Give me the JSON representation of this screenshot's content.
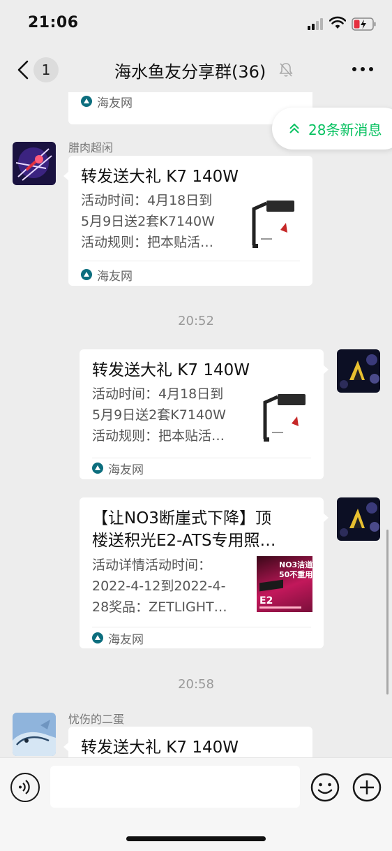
{
  "status_bar": {
    "time": "21:06"
  },
  "nav": {
    "unread_count": "1",
    "title": "海水鱼友分享群(36)"
  },
  "new_messages": {
    "label": "28条新消息"
  },
  "source_name": "海友网",
  "messages": [
    {
      "type": "card-partial",
      "side": "left",
      "source": "海友网"
    },
    {
      "type": "card",
      "side": "left",
      "sender": "腊肉超闲",
      "title_lines": [
        "转发送大礼 K7 140W"
      ],
      "desc_lines": [
        "活动时间：4月18日到",
        "5月9日送2套K7140W",
        "活动规则：把本贴活…"
      ],
      "thumb": "k7-light-icon",
      "source": "海友网"
    },
    {
      "type": "time",
      "text": "20:52"
    },
    {
      "type": "card",
      "side": "right",
      "title_lines": [
        "转发送大礼 K7 140W"
      ],
      "desc_lines": [
        "活动时间：4月18日到",
        "5月9日送2套K7140W",
        "活动规则：把本贴活…"
      ],
      "thumb": "k7-light-icon",
      "source": "海友网"
    },
    {
      "type": "card",
      "side": "right",
      "title_lines": [
        "【让NO3断崖式下降】顶",
        "楼送积光E2-ATS专用照…"
      ],
      "desc_lines": [
        "活动详情活动时间：",
        "2022-4-12到2022-4-",
        "28奖品：ZETLIGHT…"
      ],
      "thumb": "e2-product-image",
      "thumb_text": [
        "NO3洁道",
        "50不重用",
        "E2"
      ],
      "source": "海友网"
    },
    {
      "type": "time",
      "text": "20:58"
    },
    {
      "type": "card-partial-bottom",
      "side": "left",
      "sender": "忧伤的二蛋",
      "title_lines": [
        "转发送大礼 K7 140W"
      ]
    }
  ],
  "colors": {
    "accent_green": "#07c160",
    "background": "#ededed",
    "bubble": "#ffffff"
  }
}
